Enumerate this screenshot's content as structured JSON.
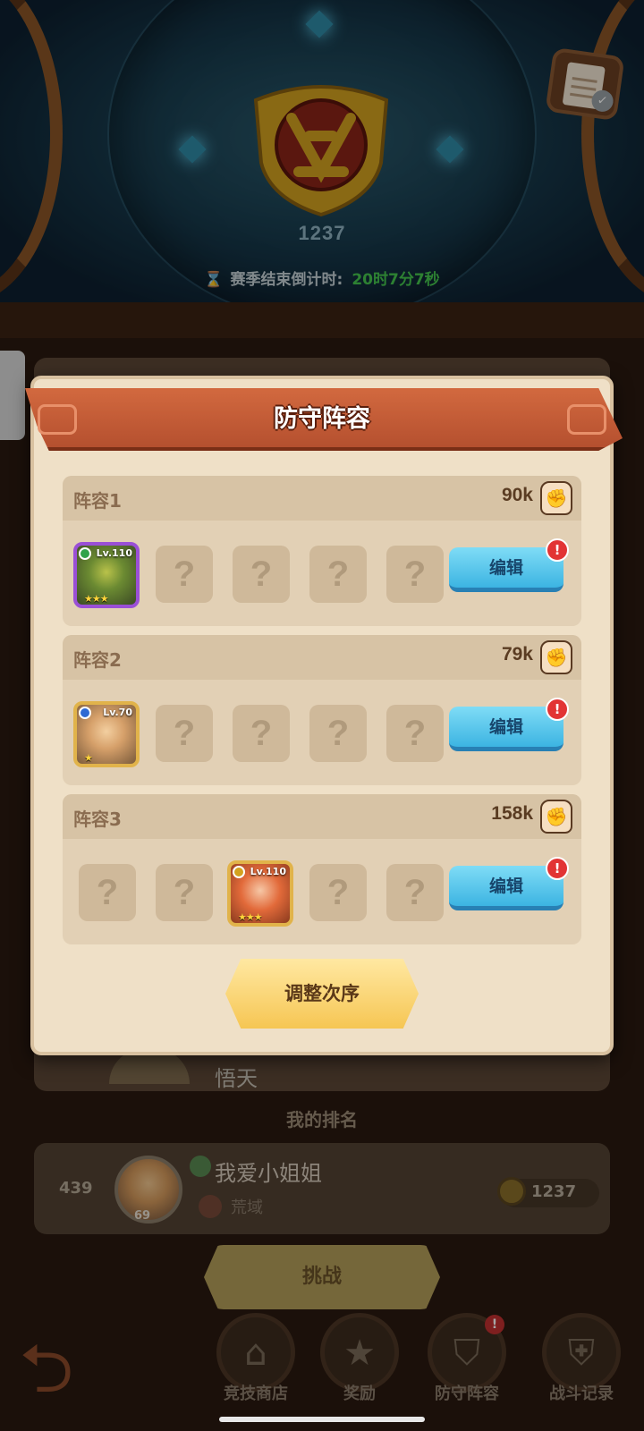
{
  "arena": {
    "score": "1237",
    "countdown_label": "赛季结束倒计时:",
    "countdown_value": "20时7分7秒"
  },
  "modal": {
    "title": "防守阵容",
    "teams": [
      {
        "name": "阵容1",
        "power": "90k",
        "edit_label": "编辑",
        "alert": "!",
        "hero_level": "Lv.110",
        "hero_stars": "★★★"
      },
      {
        "name": "阵容2",
        "power": "79k",
        "edit_label": "编辑",
        "alert": "!",
        "hero_level": "Lv.70",
        "hero_stars": "★"
      },
      {
        "name": "阵容3",
        "power": "158k",
        "edit_label": "编辑",
        "alert": "!",
        "hero_level": "Lv.110",
        "hero_stars": "★★★"
      }
    ],
    "empty_slot": "?",
    "adjust_label": "调整次序"
  },
  "background_list": {
    "partial_name": "悟天",
    "my_rank_title": "我的排名",
    "my_rank": {
      "rank": "439",
      "avatar_level": "69",
      "name": "我爱小姐姐",
      "guild": "荒域",
      "score": "1237"
    },
    "challenge_label": "挑战"
  },
  "nav": {
    "items": [
      {
        "label": "竞技商店",
        "icon": "shop-icon"
      },
      {
        "label": "奖励",
        "icon": "reward-icon"
      },
      {
        "label": "防守阵容",
        "icon": "shield-icon",
        "badge": "!"
      },
      {
        "label": "战斗记录",
        "icon": "battle-record-icon"
      }
    ]
  },
  "colors": {
    "banner": "#c45c36",
    "edit_button": "#4fc3ec",
    "adjust_button": "#f6c653",
    "alert": "#e23434",
    "timer": "#45c74e"
  }
}
